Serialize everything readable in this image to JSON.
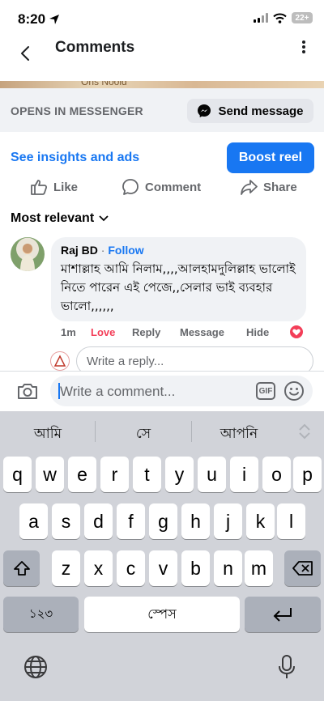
{
  "status_bar": {
    "time": "8:20",
    "battery": "22+"
  },
  "header": {
    "title": "Comments"
  },
  "media_strip_text": "Ons Noold",
  "messenger": {
    "label": "OPENS IN MESSENGER",
    "send_label": "Send message"
  },
  "promo": {
    "insights_label": "See insights and ads",
    "boost_label": "Boost reel"
  },
  "actions": {
    "like": "Like",
    "comment": "Comment",
    "share": "Share"
  },
  "sort_label": "Most relevant",
  "comment": {
    "author": "Raj BD",
    "separator": " · ",
    "follow": "Follow",
    "text": "মাশাল্লাহ আমি নিলাম,,,,আলহামদুলিল্লাহ ভালোই নিতে পারেন এই পেজে,,সেলার ভাই ব্যবহার ভালো,,,,,,",
    "time": "1m",
    "love": "Love",
    "reply": "Reply",
    "message": "Message",
    "hide": "Hide",
    "reaction_count": "1"
  },
  "reply_box": {
    "placeholder": "Write a reply..."
  },
  "composer": {
    "placeholder": "Write a comment...",
    "gif": "GIF"
  },
  "keyboard": {
    "suggestions": [
      "আমি",
      "সে",
      "আপনি"
    ],
    "row1": [
      "q",
      "w",
      "e",
      "r",
      "t",
      "y",
      "u",
      "i",
      "o",
      "p"
    ],
    "row2": [
      "a",
      "s",
      "d",
      "f",
      "g",
      "h",
      "j",
      "k",
      "l"
    ],
    "row3": [
      "z",
      "x",
      "c",
      "v",
      "b",
      "n",
      "m"
    ],
    "numbers_key": "১২৩",
    "space_key": "স্পেস"
  },
  "colors": {
    "accent": "#1877f2",
    "love": "#f33e58",
    "keyboard_bg": "#d1d3d9"
  }
}
